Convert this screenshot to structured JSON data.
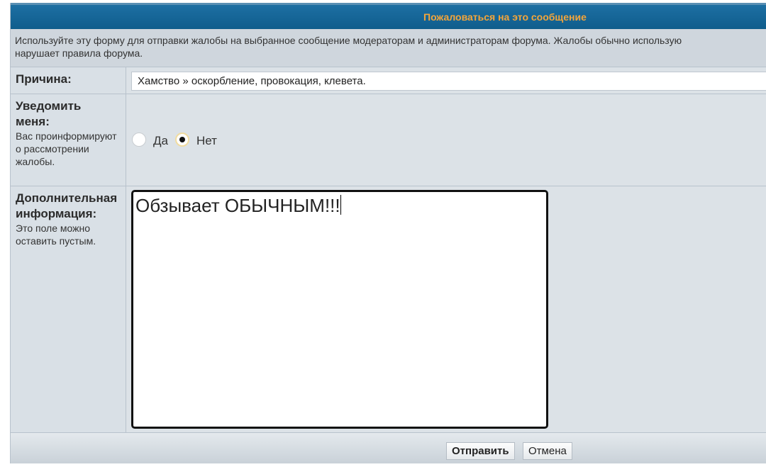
{
  "header": {
    "title": "Пожаловаться на это сообщение"
  },
  "intro": {
    "line1": "Используйте эту форму для отправки жалобы на выбранное сообщение модераторам и администраторам форума. Жалобы обычно использую",
    "line2": "нарушает правила форума."
  },
  "reason": {
    "label": "Причина:",
    "selected": "Хамство » оскорбление, провокация, клевета."
  },
  "notify": {
    "label_line1": "Уведомить",
    "label_line2": "меня:",
    "desc": "Вас проинформируют о рассмотрении жалобы.",
    "options": [
      {
        "label": "Да",
        "checked": false
      },
      {
        "label": "Нет",
        "checked": true
      }
    ]
  },
  "extra": {
    "label_line1": "Дополнительная",
    "label_line2": "информация:",
    "desc": "Это поле можно оставить пустым.",
    "value": "Обзывает ОБЫЧНЫМ!!!"
  },
  "buttons": {
    "submit": "Отправить",
    "cancel": "Отмена"
  },
  "colors": {
    "header_bg": "#0f5d8c",
    "header_text": "#f4a53a",
    "panel_bg": "#dce2e7"
  }
}
